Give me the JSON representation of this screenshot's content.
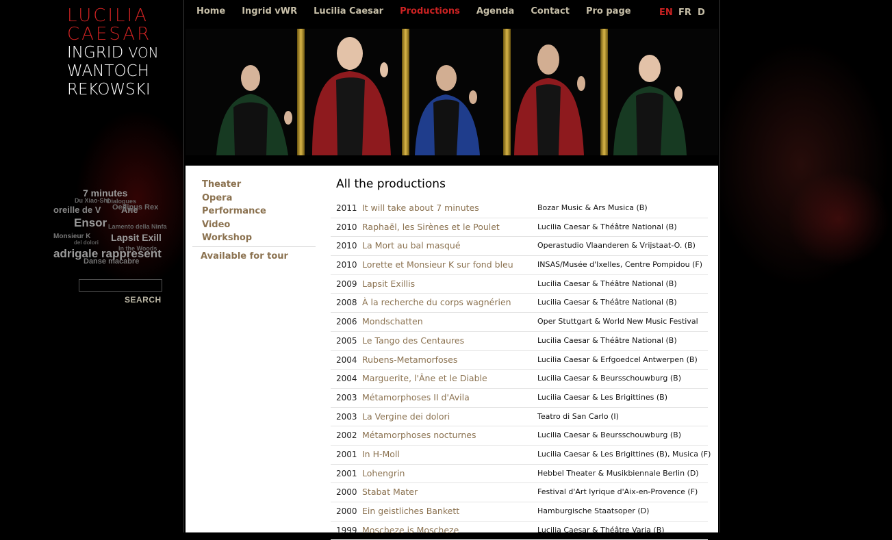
{
  "logo": {
    "line1": "LUCILIA",
    "line2": "CAESAR",
    "line3a": "INGRID",
    "line3b": "VON",
    "line4": "WANTOCH",
    "line5": "REKOWSKI"
  },
  "nav": {
    "items": [
      {
        "label": "Home"
      },
      {
        "label": "Ingrid vWR"
      },
      {
        "label": "Lucilia Caesar"
      },
      {
        "label": "Productions",
        "active": true
      },
      {
        "label": "Agenda"
      },
      {
        "label": "Contact"
      },
      {
        "label": "Pro page"
      }
    ],
    "languages": [
      {
        "label": "EN",
        "active": true
      },
      {
        "label": "FR"
      },
      {
        "label": "D"
      }
    ]
  },
  "tag_cloud": [
    {
      "text": "7 minutes"
    },
    {
      "text": "Du Xiao-Shi"
    },
    {
      "text": "Dialogues"
    },
    {
      "text": "oreille de V"
    },
    {
      "text": "Âne"
    },
    {
      "text": "Oedipus Rex"
    },
    {
      "text": "Ensor"
    },
    {
      "text": "Lamento della Ninfa"
    },
    {
      "text": "Monsieur K"
    },
    {
      "text": "del dolori"
    },
    {
      "text": "Lapsit Exill"
    },
    {
      "text": "In the Woods"
    },
    {
      "text": "adrigale rappresent"
    },
    {
      "text": "Danse macabre"
    }
  ],
  "search": {
    "button": "SEARCH",
    "placeholder": ""
  },
  "sidebar": {
    "categories": [
      "Theater",
      "Opera",
      "Performance",
      "Video",
      "Workshop"
    ],
    "tour": "Available for tour"
  },
  "productions": {
    "title": "All the productions",
    "items": [
      {
        "year": "2011",
        "name": "It will take about 7 minutes",
        "venue": "Bozar Music & Ars Musica (B)"
      },
      {
        "year": "2010",
        "name": "Raphaël, les Sirènes et le Poulet",
        "venue": "Lucilia Caesar & Théâtre National (B)"
      },
      {
        "year": "2010",
        "name": "La Mort au bal masqué",
        "venue": "Operastudio Vlaanderen & Vrijstaat-O. (B)"
      },
      {
        "year": "2010",
        "name": "Lorette et Monsieur K sur fond bleu",
        "venue": "INSAS/Musée d'Ixelles, Centre Pompidou (F)"
      },
      {
        "year": "2009",
        "name": "Lapsit Exillis",
        "venue": "Lucilia Caesar & Théâtre National (B)"
      },
      {
        "year": "2008",
        "name": "À la recherche du corps wagnérien",
        "venue": "Lucilia Caesar & Théâtre National (B)"
      },
      {
        "year": "2006",
        "name": "Mondschatten",
        "venue": "Oper Stuttgart & World New Music Festival"
      },
      {
        "year": "2005",
        "name": "Le Tango des Centaures",
        "venue": "Lucilia Caesar & Théâtre National (B)"
      },
      {
        "year": "2004",
        "name": "Rubens-Metamorfoses",
        "venue": "Lucilia Caesar & Erfgoedcel Antwerpen (B)"
      },
      {
        "year": "2004",
        "name": "Marguerite, l'Âne et le Diable",
        "venue": "Lucilia Caesar & Beursschouwburg (B)"
      },
      {
        "year": "2003",
        "name": "Métamorphoses II d'Avila",
        "venue": "Lucilia Caesar & Les Brigittines (B)"
      },
      {
        "year": "2003",
        "name": "La Vergine dei dolori",
        "venue": "Teatro di San Carlo (I)"
      },
      {
        "year": "2002",
        "name": "Métamorphoses nocturnes",
        "venue": "Lucilia Caesar & Beursschouwburg (B)"
      },
      {
        "year": "2001",
        "name": "In H-Moll",
        "venue": "Lucilia Caesar & Les Brigittines (B), Musica (F)"
      },
      {
        "year": "2001",
        "name": "Lohengrin",
        "venue": "Hebbel Theater & Musikbiennale Berlin (D)"
      },
      {
        "year": "2000",
        "name": "Stabat Mater",
        "venue": "Festival d'Art lyrique d'Aix-en-Provence (F)"
      },
      {
        "year": "2000",
        "name": "Ein geistliches Bankett",
        "venue": "Hamburgische Staatsoper (D)"
      },
      {
        "year": "1999",
        "name": "Moscheze is Moscheze",
        "venue": "Lucilia Caesar & Théâtre Varia (B)"
      }
    ]
  },
  "colors": {
    "accent": "#cc2222",
    "link": "#8b7250",
    "nav": "#c7bfa8"
  }
}
